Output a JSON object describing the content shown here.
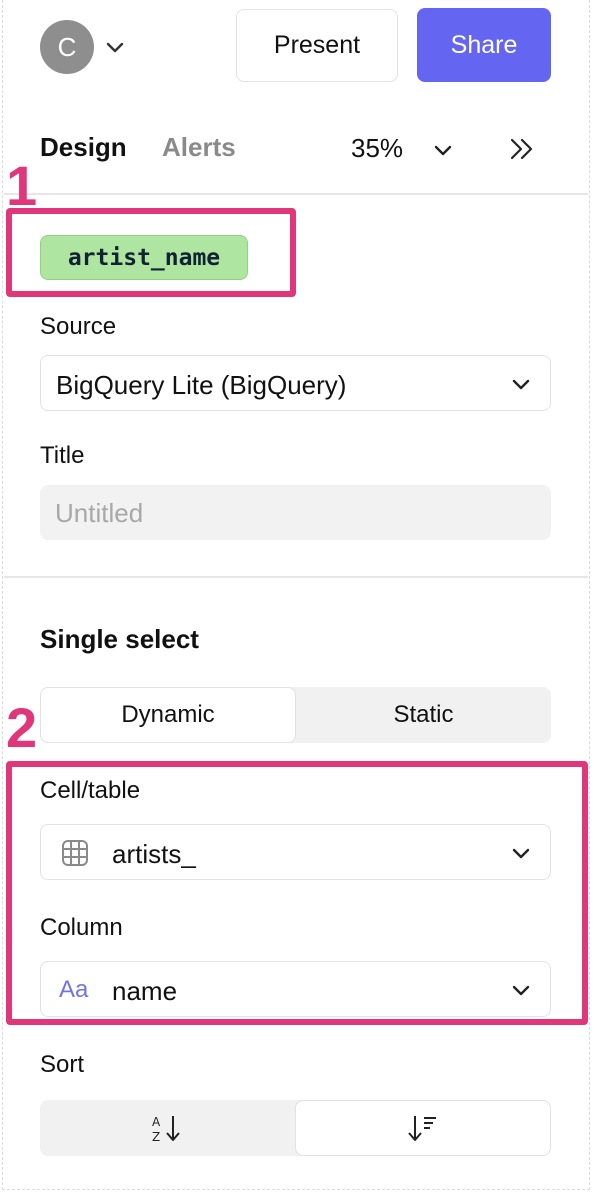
{
  "header": {
    "avatar_initial": "C",
    "present_label": "Present",
    "share_label": "Share"
  },
  "tabs": {
    "design": "Design",
    "alerts": "Alerts",
    "zoom": "35%"
  },
  "annotations": {
    "one": "1",
    "two": "2",
    "color": "#e0367a"
  },
  "element": {
    "chip_label": "artist_name",
    "chip_color": "#aee5a0"
  },
  "source": {
    "label": "Source",
    "value": "BigQuery Lite (BigQuery)"
  },
  "title_field": {
    "label": "Title",
    "placeholder": "Untitled"
  },
  "single_select": {
    "heading": "Single select",
    "options": [
      "Dynamic",
      "Static"
    ],
    "selected": "Dynamic"
  },
  "cell_table": {
    "label": "Cell/table",
    "value": "artists_",
    "icon": "table-grid-icon"
  },
  "column": {
    "label": "Column",
    "value": "name",
    "icon_text": "Aa"
  },
  "sort": {
    "label": "Sort",
    "options": [
      "sort-az-icon",
      "sort-desc-icon"
    ]
  },
  "colors": {
    "share_bg": "#6466f1",
    "aa_icon": "#6f74e8"
  }
}
